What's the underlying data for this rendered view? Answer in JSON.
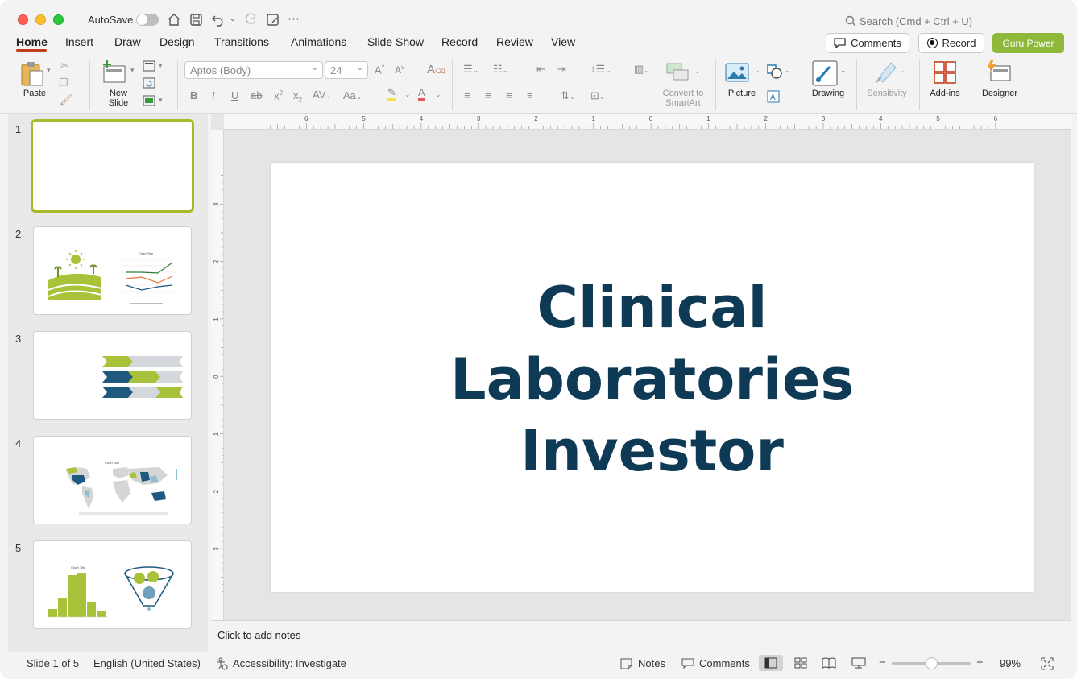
{
  "titlebar": {
    "autosave_label": "AutoSave",
    "search_placeholder": "Search (Cmd + Ctrl + U)"
  },
  "tabs": [
    "Home",
    "Insert",
    "Draw",
    "Design",
    "Transitions",
    "Animations",
    "Slide Show",
    "Record",
    "Review",
    "View"
  ],
  "header_buttons": {
    "comments": "Comments",
    "record": "Record",
    "guru": "Guru Power"
  },
  "ribbon": {
    "paste": "Paste",
    "new_slide": "New Slide",
    "font_name": "Aptos (Body)",
    "font_size": "24",
    "convert_smartart": "Convert to SmartArt",
    "picture": "Picture",
    "drawing": "Drawing",
    "sensitivity": "Sensitivity",
    "addins": "Add-ins",
    "designer": "Designer"
  },
  "thumbnails": [
    {
      "num": "1"
    },
    {
      "num": "2",
      "chart_title": "Chart Title"
    },
    {
      "num": "3"
    },
    {
      "num": "4",
      "chart_title": "Chart Title"
    },
    {
      "num": "5",
      "chart_title": "Chart Title"
    }
  ],
  "ruler": {
    "h_ticks": [
      "6",
      "5",
      "4",
      "3",
      "2",
      "1",
      "0",
      "1",
      "2",
      "3",
      "4",
      "5",
      "6"
    ],
    "v_ticks": [
      "3",
      "2",
      "1",
      "0",
      "1",
      "2",
      "3"
    ]
  },
  "slide": {
    "title_line1": "Clinical",
    "title_line2": "Laboratories",
    "title_line3": "Investor"
  },
  "notes_placeholder": "Click to add notes",
  "status": {
    "slide_info": "Slide 1 of 5",
    "language": "English (United States)",
    "accessibility": "Accessibility: Investigate",
    "notes": "Notes",
    "comments": "Comments",
    "zoom": "99%"
  },
  "colors": {
    "accent_red": "#c43e1c",
    "guru_green": "#8db83a",
    "title_navy": "#0e3a56",
    "thumb_green": "#a8c23a",
    "thumb_blue": "#1f5a7e"
  }
}
